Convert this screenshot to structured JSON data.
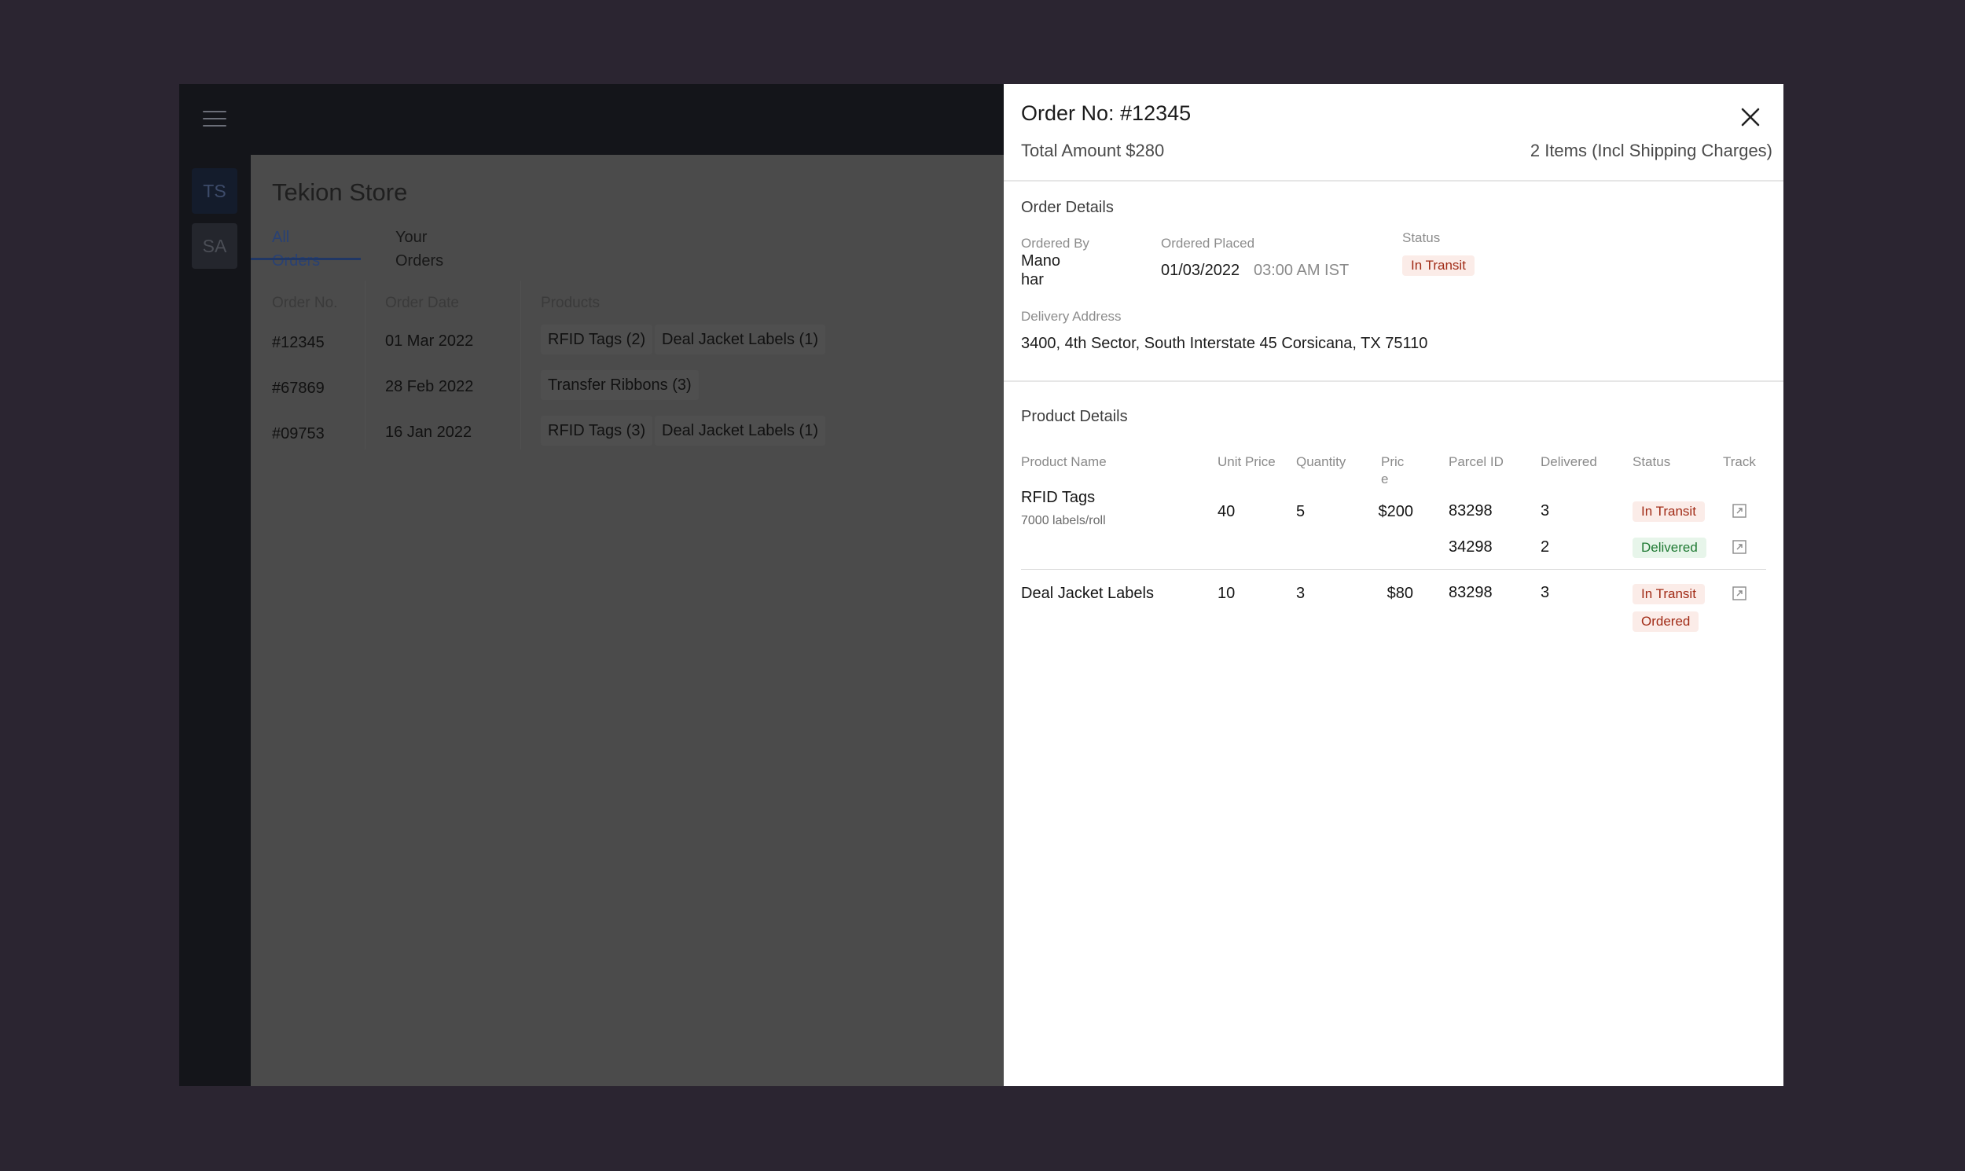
{
  "app": {
    "store_title": "Tekion Store",
    "avatars": [
      "TS",
      "SA"
    ],
    "tabs": [
      {
        "label": "All Orders",
        "active": true
      },
      {
        "label": "Your Orders",
        "active": false
      }
    ],
    "columns": [
      "Order No.",
      "Order Date",
      "Products"
    ],
    "orders": [
      {
        "no": "#12345",
        "date": "01 Mar 2022",
        "products": [
          "RFID Tags (2)",
          "Deal Jacket Labels (1)"
        ]
      },
      {
        "no": "#67869",
        "date": "28 Feb 2022",
        "products": [
          "Transfer Ribbons (3)"
        ]
      },
      {
        "no": "#09753",
        "date": "16 Jan 2022",
        "products": [
          "RFID Tags (3)",
          "Deal Jacket Labels (1)"
        ]
      }
    ]
  },
  "drawer": {
    "title": "Order No: #12345",
    "total": "Total Amount $280",
    "items": "2 Items (Incl Shipping Charges)",
    "order_details": {
      "section_title": "Order Details",
      "ordered_by_label": "Ordered By",
      "ordered_by_line1": "Mano",
      "ordered_by_line2": "har",
      "placed_label": "Ordered Placed",
      "placed_date": "01/03/2022",
      "placed_time": "03:00 AM IST",
      "status_label": "Status",
      "status": "In Transit",
      "address_label": "Delivery Address",
      "address": "3400, 4th Sector, South Interstate 45 Corsicana, TX 75110"
    },
    "product_details": {
      "section_title": "Product Details",
      "headers": {
        "name": "Product Name",
        "unit_price": "Unit Price",
        "quantity": "Quantity",
        "price_line1": "Pric",
        "price_line2": "e",
        "parcel": "Parcel ID",
        "delivered": "Delivered",
        "status": "Status",
        "track": "Track"
      },
      "products": [
        {
          "name": "RFID Tags",
          "sub": "7000 labels/roll",
          "unit_price": "40",
          "quantity": "5",
          "price": "$200",
          "parcels": [
            {
              "id": "83298",
              "delivered": "3",
              "status": "In Transit"
            },
            {
              "id": "34298",
              "delivered": "2",
              "status": "Delivered"
            }
          ]
        },
        {
          "name": "Deal Jacket Labels",
          "unit_price": "10",
          "quantity": "3",
          "price": "$80",
          "parcels": [
            {
              "id": "83298",
              "delivered": "3",
              "status": "In Transit"
            }
          ],
          "extra_status": "Ordered"
        }
      ]
    },
    "colors": {
      "transit_bg": "#fbece8",
      "transit_fg": "#a12b16",
      "delivered_bg": "#e7f5ea",
      "delivered_fg": "#1f7a33"
    }
  }
}
